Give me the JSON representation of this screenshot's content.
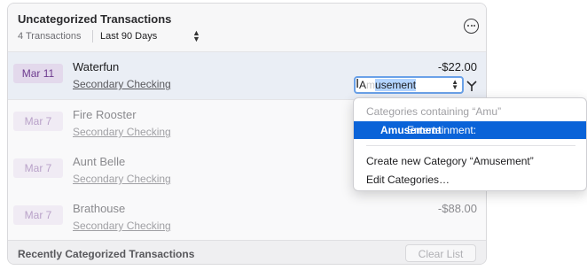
{
  "header": {
    "title": "Uncategorized Transactions",
    "count": "4 Transactions",
    "period": "Last 90 Days"
  },
  "transactions": [
    {
      "date": "Mar 11",
      "payee": "Waterfun",
      "account": "Secondary Checking",
      "amount": "-$22.00"
    },
    {
      "date": "Mar 7",
      "payee": "Fire Rooster",
      "account": "Secondary Checking",
      "amount": ""
    },
    {
      "date": "Mar 7",
      "payee": "Aunt Belle",
      "account": "Secondary Checking",
      "amount": ""
    },
    {
      "date": "Mar 7",
      "payee": "Brathouse",
      "account": "Secondary Checking",
      "amount": "-$88.00"
    }
  ],
  "category_field": {
    "typed_prefix": "A",
    "cursor_obscured": "m",
    "selection": "usement"
  },
  "dropdown": {
    "header": "Categories containing “Amu”",
    "match_prefix": "Entertainment:",
    "match_bold": "Amusement",
    "create": "Create new Category “Amusement”",
    "edit": "Edit Categories…"
  },
  "footer": {
    "title": "Recently Categorized Transactions",
    "clear_label": "Clear List"
  },
  "colors": {
    "accent": "#0a63d8",
    "date_badge": "#e3d9ec",
    "selected_row": "#eaeef5"
  }
}
